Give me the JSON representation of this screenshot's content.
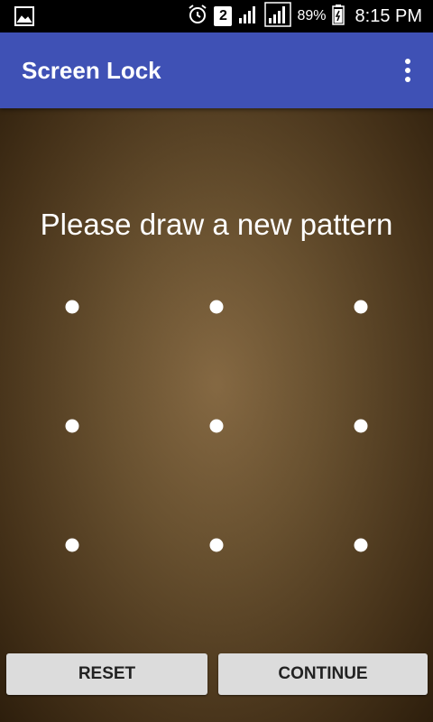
{
  "status_bar": {
    "battery_percent": "89%",
    "time": "8:15 PM",
    "sim_slot": "2",
    "icons": [
      "gallery-icon",
      "alarm-icon",
      "sim-2-icon",
      "signal-icon",
      "signal-icon-2",
      "battery-icon"
    ]
  },
  "app_bar": {
    "title": "Screen Lock",
    "color": "#3f51b5",
    "menu_icon": "overflow-menu-icon"
  },
  "prompt": "Please draw a new pattern",
  "pattern_dots": 9,
  "buttons": {
    "reset": "RESET",
    "continue": "CONTINUE"
  }
}
